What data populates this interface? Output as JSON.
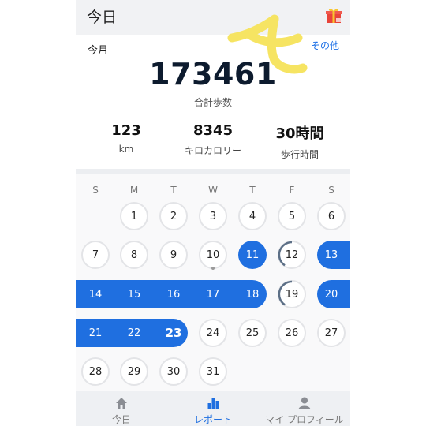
{
  "header": {
    "title": "今日",
    "gift_icon": "gift-icon"
  },
  "summary": {
    "period_label": "今月",
    "other_link": "その他",
    "total_steps": "173461",
    "total_steps_label": "合計歩数",
    "stats": [
      {
        "value": "123",
        "label": "km"
      },
      {
        "value": "8345",
        "label": "キロカロリー"
      },
      {
        "value": "30時間",
        "label": "歩行時間"
      }
    ]
  },
  "calendar": {
    "weekdays": [
      "S",
      "M",
      "T",
      "W",
      "T",
      "F",
      "S"
    ],
    "days": [
      "1",
      "2",
      "3",
      "4",
      "5",
      "6",
      "7",
      "8",
      "9",
      "10",
      "11",
      "12",
      "13",
      "14",
      "15",
      "16",
      "17",
      "18",
      "19",
      "20",
      "21",
      "22",
      "23",
      "24",
      "25",
      "26",
      "27",
      "28",
      "29",
      "30",
      "31"
    ],
    "goal_reached_days": [
      11,
      13,
      14,
      15,
      16,
      17,
      18,
      20,
      21,
      22,
      23
    ],
    "partial_progress_days": [
      12,
      19
    ],
    "today": 23,
    "marked_day": 10,
    "accent_color": "#1f6fe0"
  },
  "nav": {
    "items": [
      {
        "label": "今日",
        "icon": "home-icon"
      },
      {
        "label": "レポート",
        "icon": "bar-chart-icon"
      },
      {
        "label": "マイ プロフィール",
        "icon": "person-icon"
      }
    ],
    "active_index": 1
  }
}
